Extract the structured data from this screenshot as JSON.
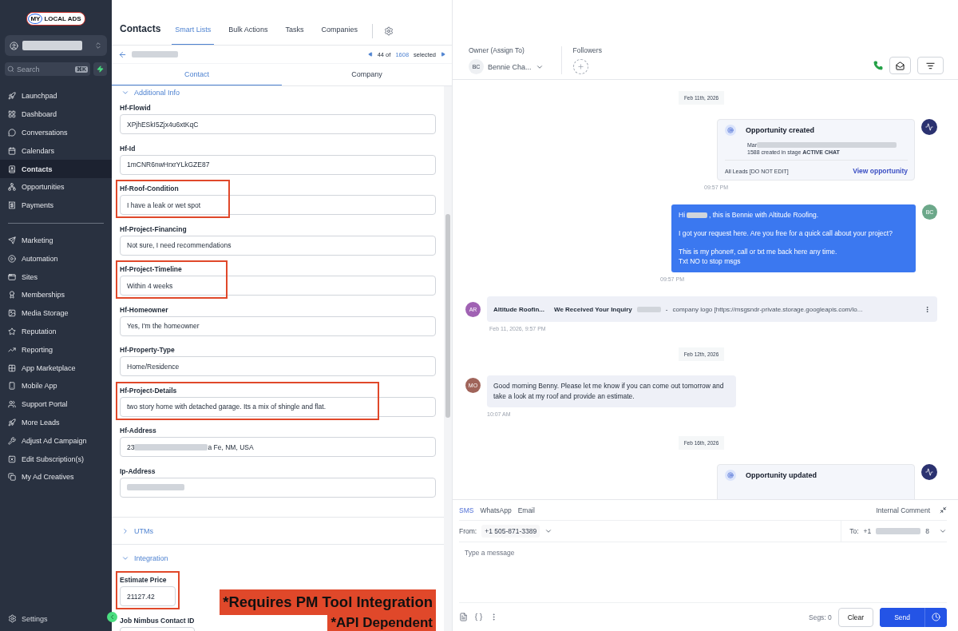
{
  "brand": {
    "badge": "MY",
    "name": "LOCAL ADS"
  },
  "sidebar": {
    "search": {
      "placeholder": "Search",
      "shortcut": "⌘K"
    },
    "groups": [
      {
        "items": [
          {
            "label": "Launchpad",
            "selected": false
          },
          {
            "label": "Dashboard",
            "selected": false
          },
          {
            "label": "Conversations",
            "selected": false
          },
          {
            "label": "Calendars",
            "selected": false
          },
          {
            "label": "Contacts",
            "selected": true
          },
          {
            "label": "Opportunities",
            "selected": false
          },
          {
            "label": "Payments",
            "selected": false
          }
        ]
      },
      {
        "items": [
          {
            "label": "Marketing",
            "selected": false
          },
          {
            "label": "Automation",
            "selected": false
          },
          {
            "label": "Sites",
            "selected": false
          },
          {
            "label": "Memberships",
            "selected": false
          },
          {
            "label": "Media Storage",
            "selected": false
          },
          {
            "label": "Reputation",
            "selected": false
          },
          {
            "label": "Reporting",
            "selected": false
          },
          {
            "label": "App Marketplace",
            "selected": false
          },
          {
            "label": "Mobile App",
            "selected": false
          },
          {
            "label": "Support Portal",
            "selected": false
          },
          {
            "label": "More Leads",
            "selected": false
          },
          {
            "label": "Adjust Ad Campaign",
            "selected": false
          },
          {
            "label": "Edit Subscription(s)",
            "selected": false
          },
          {
            "label": "My Ad Creatives",
            "selected": false
          }
        ]
      }
    ],
    "settings": "Settings"
  },
  "header": {
    "title": "Contacts",
    "tabs": [
      {
        "label": "Smart Lists",
        "selected": true
      },
      {
        "label": "Bulk Actions",
        "selected": false
      },
      {
        "label": "Tasks",
        "selected": false
      },
      {
        "label": "Companies",
        "selected": false
      }
    ]
  },
  "pager": {
    "position": "44 of",
    "total": "1608",
    "suffix": "selected"
  },
  "detail_tabs": [
    {
      "label": "Contact",
      "selected": true
    },
    {
      "label": "Company",
      "selected": false
    }
  ],
  "sections": [
    {
      "title": "Additional Info",
      "expanded": true,
      "fields": [
        {
          "label": "Hf-Flowid",
          "value": "XPjhESkI5Zjx4u6xtKqC",
          "highlighted": false
        },
        {
          "label": "Hf-Id",
          "value": "1mCNR6nwHrxrYLkGZE87",
          "highlighted": false
        },
        {
          "label": "Hf-Roof-Condition",
          "value": "I have a leak or wet spot",
          "highlighted": true
        },
        {
          "label": "Hf-Project-Financing",
          "value": "Not sure, I need recommendations",
          "highlighted": false
        },
        {
          "label": "Hf-Project-Timeline",
          "value": "Within 4 weeks",
          "highlighted": true
        },
        {
          "label": "Hf-Homeowner",
          "value": "Yes, I'm the homeowner",
          "highlighted": false
        },
        {
          "label": "Hf-Property-Type",
          "value": "Home/Residence",
          "highlighted": false
        },
        {
          "label": "Hf-Project-Details",
          "value": "two story home with detached garage. Its a mix of shingle and flat.",
          "highlighted": true
        },
        {
          "label": "Hf-Address",
          "value": "23",
          "value_end": "a Fe, NM, USA",
          "redacted": true,
          "highlighted": false
        },
        {
          "label": "Ip-Address",
          "redacted": true,
          "highlighted": false
        }
      ]
    },
    {
      "title": "UTMs",
      "expanded": false
    },
    {
      "title": "Integration",
      "expanded": true,
      "fields": [
        {
          "label": "Estimate Price",
          "value": "21127.42",
          "highlighted": true,
          "callout": "*Requires PM Tool Integration"
        },
        {
          "label": "Job Nimbus Contact ID",
          "highlighted": false,
          "callout": "*API Dependent"
        }
      ]
    }
  ],
  "owner": {
    "label": "Owner (Assign To)",
    "initials": "BC",
    "name": "Bennie Cha..."
  },
  "followers": {
    "label": "Followers"
  },
  "messages": [
    {
      "kind": "date",
      "text": "Feb 11th, 2026"
    },
    {
      "kind": "activity",
      "title": "Opportunity created",
      "line_start": "Mar",
      "detail": "1588 created in stage **ACTIVE CHAT**",
      "footer": "All Leads [DO NOT EDIT]",
      "link": "View opportunity",
      "time": "09:57 PM"
    },
    {
      "kind": "outbound",
      "initials": "BC",
      "greeting_start": "Hi",
      "greeting_end": ", this is Bennie with Altitude Roofing.",
      "paragraphs": [
        "I got your request here. Are you free for a quick call about your project?",
        "This is my phone#, call or txt me back here any time.\nTxt NO to stop msgs"
      ],
      "time": "09:57 PM"
    },
    {
      "kind": "email",
      "initials": "AR",
      "sender": "Altitude Roofin...",
      "subject": "We Received Your Inquiry",
      "separator": "-",
      "preview": "company logo [https://msgsndr-private.storage.googleapis.com/lo...",
      "time": "Feb 11, 2026, 9:57 PM"
    },
    {
      "kind": "date",
      "text": "Feb 12th, 2026"
    },
    {
      "kind": "sms",
      "initials": "MO",
      "text": "Good morning Benny. Please let me know if you can come out tomorrow and take a look at my roof and provide an estimate.",
      "time": "10:07 AM"
    },
    {
      "kind": "date",
      "text": "Feb 16th, 2026"
    },
    {
      "kind": "activity",
      "title": "Opportunity updated"
    }
  ],
  "composer": {
    "channels": [
      {
        "label": "SMS",
        "selected": true
      },
      {
        "label": "WhatsApp",
        "selected": false
      },
      {
        "label": "Email",
        "selected": false
      }
    ],
    "internal": "Internal Comment",
    "from_label": "From:",
    "from": "+1 505-871-3389",
    "to_label": "To:",
    "to_start": "+1",
    "to_end": "8",
    "placeholder": "Type a message",
    "segments": "Segs: 0",
    "clear": "Clear",
    "send": "Send"
  }
}
